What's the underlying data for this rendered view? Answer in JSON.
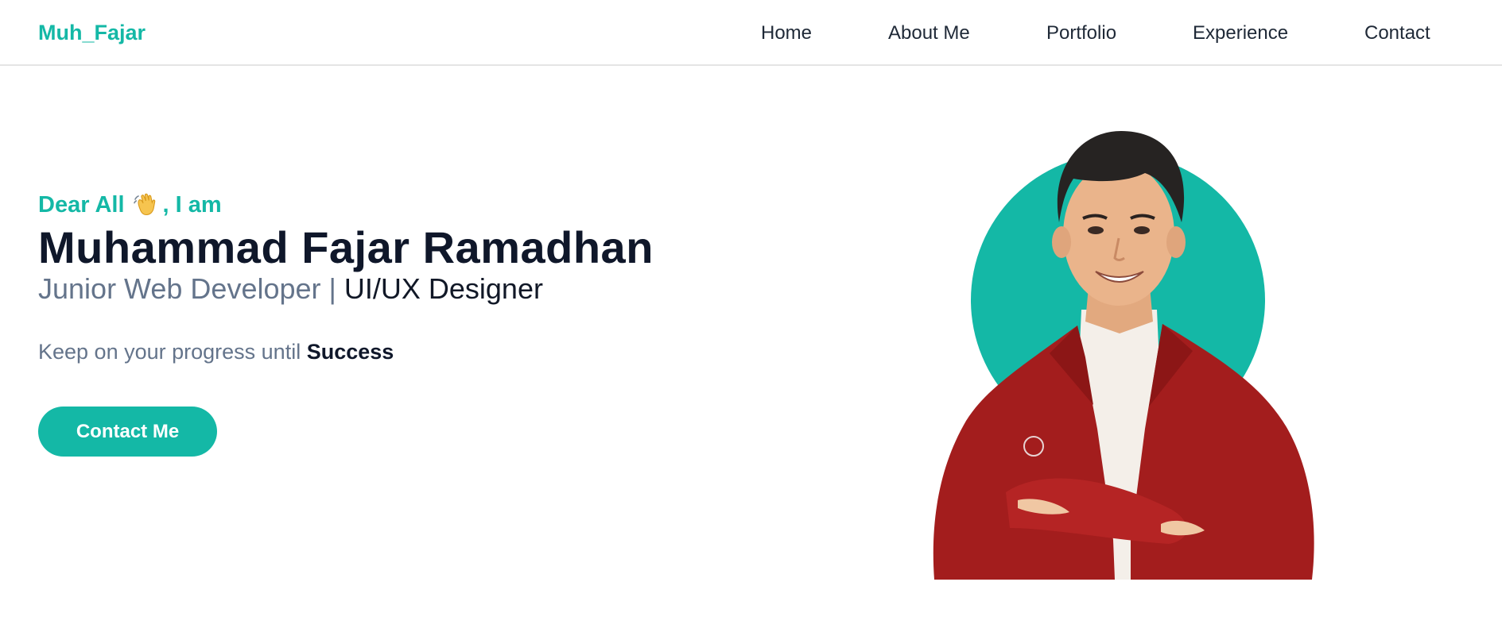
{
  "brand": {
    "name": "Muh_Fajar"
  },
  "nav": {
    "items": [
      {
        "label": "Home"
      },
      {
        "label": "About Me"
      },
      {
        "label": "Portfolio"
      },
      {
        "label": "Experience"
      },
      {
        "label": "Contact"
      }
    ]
  },
  "hero": {
    "greeting_prefix": "Dear All",
    "greeting_icon": "waving-hand-icon",
    "greeting_suffix": ", I am",
    "name": "Muhammad Fajar Ramadhan",
    "role_primary": "Junior Web Developer | ",
    "role_secondary": "UI/UX Designer",
    "tagline_text": "Keep on your progress until ",
    "tagline_emphasis": "Success",
    "cta_label": "Contact Me"
  },
  "colors": {
    "accent": "#14b8a6",
    "heading": "#0f172a",
    "muted": "#64748b",
    "nav_text": "#1f2937",
    "jacket": "#a31d1d"
  }
}
